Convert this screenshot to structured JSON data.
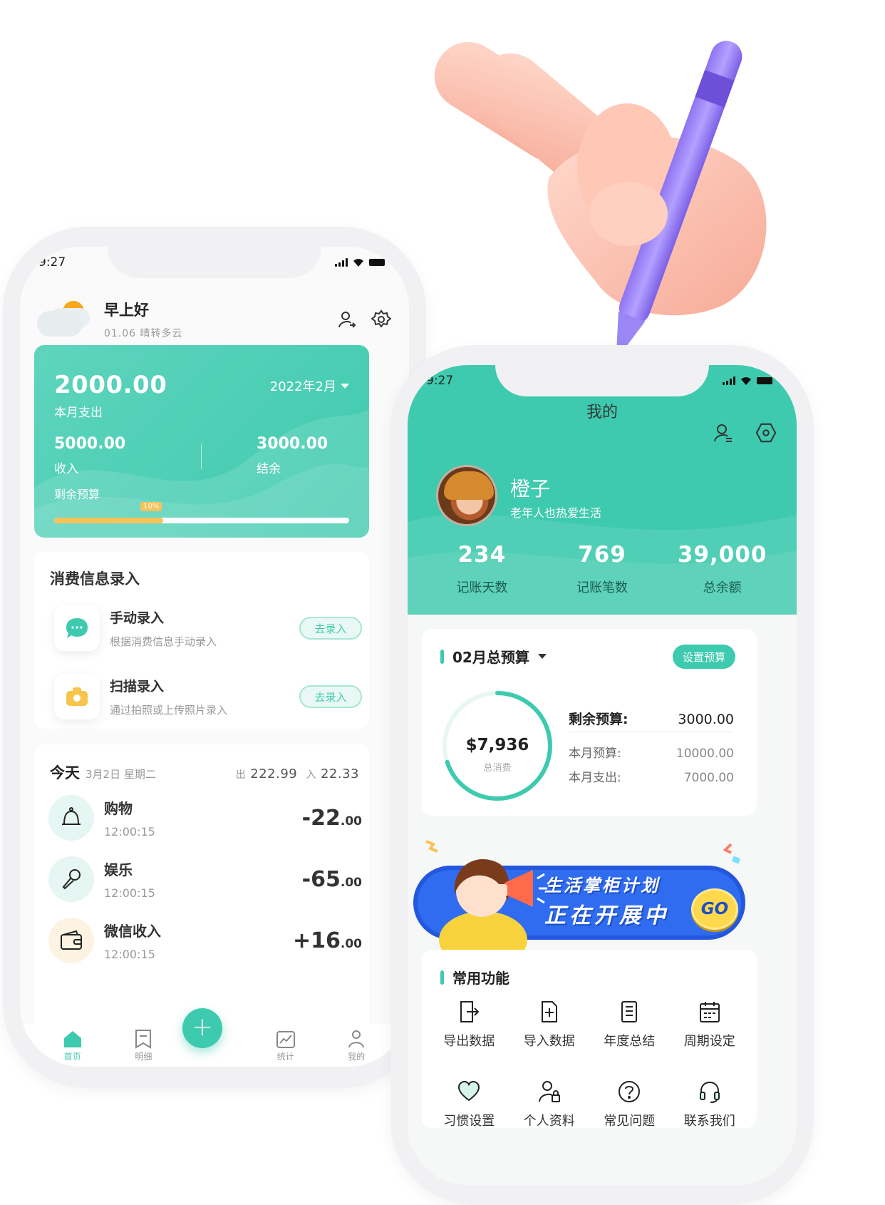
{
  "colors": {
    "primary": "#3ecaae",
    "accent_yellow": "#f6c25a",
    "banner_blue": "#2357de"
  },
  "home": {
    "status_time": "9:27",
    "greeting": "早上好",
    "weather_line": "01.06 晴转多云",
    "header_icons": [
      "user-switch-icon",
      "settings-icon"
    ],
    "summary": {
      "amount": "2000.00",
      "amount_label": "本月支出",
      "month": "2022年2月",
      "income_value": "5000.00",
      "income_label": "收入",
      "balance_value": "3000.00",
      "balance_label": "结余",
      "budget_label": "剩余预算",
      "progress_text": "10%",
      "progress_fraction": 0.37
    },
    "entry": {
      "title": "消费信息录入",
      "items": [
        {
          "name": "手动录入",
          "desc": "根据消费信息手动录入",
          "button": "去录入",
          "icon": "chat-bubble-icon"
        },
        {
          "name": "扫描录入",
          "desc": "通过拍照或上传照片录入",
          "button": "去录入",
          "icon": "camera-icon"
        }
      ]
    },
    "transactions": {
      "today": "今天",
      "date": "3月2日 星期二",
      "out_label": "出",
      "out_value": "222.99",
      "in_label": "入",
      "in_value": "22.33",
      "items": [
        {
          "name": "购物",
          "time": "12:00:15",
          "amount_int": "-22",
          "amount_dec": ".00",
          "icon": "bell-icon"
        },
        {
          "name": "娱乐",
          "time": "12:00:15",
          "amount_int": "-65",
          "amount_dec": ".00",
          "icon": "microphone-icon"
        },
        {
          "name": "微信收入",
          "time": "12:00:15",
          "amount_int": "+16",
          "amount_dec": ".00",
          "icon": "wallet-icon"
        }
      ]
    },
    "tabs": [
      {
        "label": "首页",
        "icon": "home-icon",
        "active": true
      },
      {
        "label": "明细",
        "icon": "bookmark-icon",
        "active": false
      },
      {
        "label": "统计",
        "icon": "chart-icon",
        "active": false
      },
      {
        "label": "我的",
        "icon": "person-icon",
        "active": false
      }
    ],
    "fab_symbol": "+"
  },
  "profile": {
    "status_time": "9:27",
    "title": "我的",
    "header_icons": [
      "user-switch-icon",
      "hexagon-settings-icon"
    ],
    "name": "橙子",
    "motto": "老年人也热爱生活",
    "stats": [
      {
        "value": "234",
        "label": "记账天数"
      },
      {
        "value": "769",
        "label": "记账笔数"
      },
      {
        "value": "39,000",
        "label": "总余额"
      }
    ],
    "budget": {
      "title": "02月总预算",
      "set_button": "设置预算",
      "total_spend": "$7,936",
      "total_spend_label": "总消费",
      "spend_fraction": 0.7,
      "remaining_label": "剩余预算:",
      "remaining_value": "3000.00",
      "month_budget_label": "本月预算:",
      "month_budget_value": "10000.00",
      "month_spend_label": "本月支出:",
      "month_spend_value": "7000.00"
    },
    "banner": {
      "line1": "生活掌柜计划",
      "line2": "正在开展中",
      "go": "GO"
    },
    "functions": {
      "title": "常用功能",
      "items": [
        {
          "label": "导出数据",
          "icon": "export-icon"
        },
        {
          "label": "导入数据",
          "icon": "import-icon"
        },
        {
          "label": "年度总结",
          "icon": "document-icon"
        },
        {
          "label": "周期设定",
          "icon": "calendar-icon"
        },
        {
          "label": "习惯设置",
          "icon": "heart-icon"
        },
        {
          "label": "个人资料",
          "icon": "user-lock-icon"
        },
        {
          "label": "常见问题",
          "icon": "question-icon"
        },
        {
          "label": "联系我们",
          "icon": "headset-icon"
        }
      ]
    }
  }
}
